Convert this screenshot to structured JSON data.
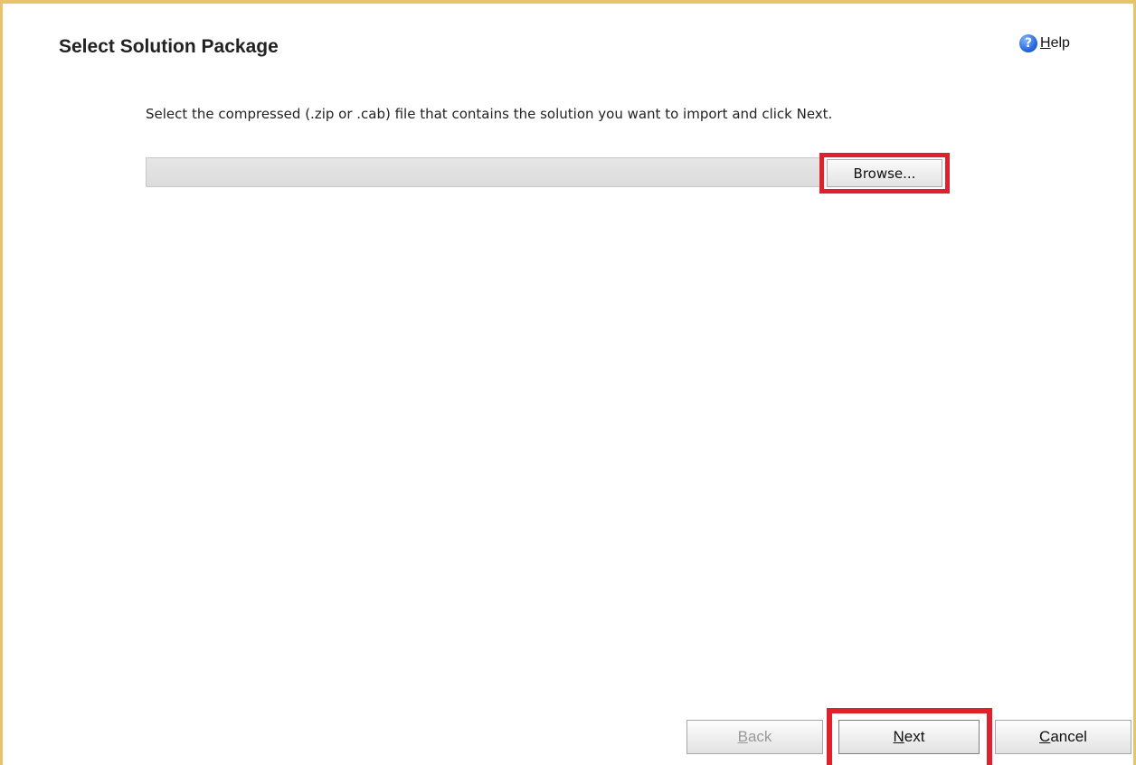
{
  "page": {
    "title": "Select Solution Package",
    "help": {
      "icon": "help-icon",
      "label_first": "H",
      "label_rest": "elp"
    },
    "instruction": "Select the compressed (.zip or .cab) file that contains the solution you want to import and click Next."
  },
  "file_picker": {
    "value": "",
    "browse_label": "Browse..."
  },
  "footer": {
    "back": {
      "first": "B",
      "rest": "ack",
      "enabled": false
    },
    "next": {
      "first": "N",
      "rest": "ext"
    },
    "cancel": {
      "first": "C",
      "rest": "ancel"
    }
  },
  "colors": {
    "highlight": "#e0212d",
    "frame": "#e7c46a"
  }
}
